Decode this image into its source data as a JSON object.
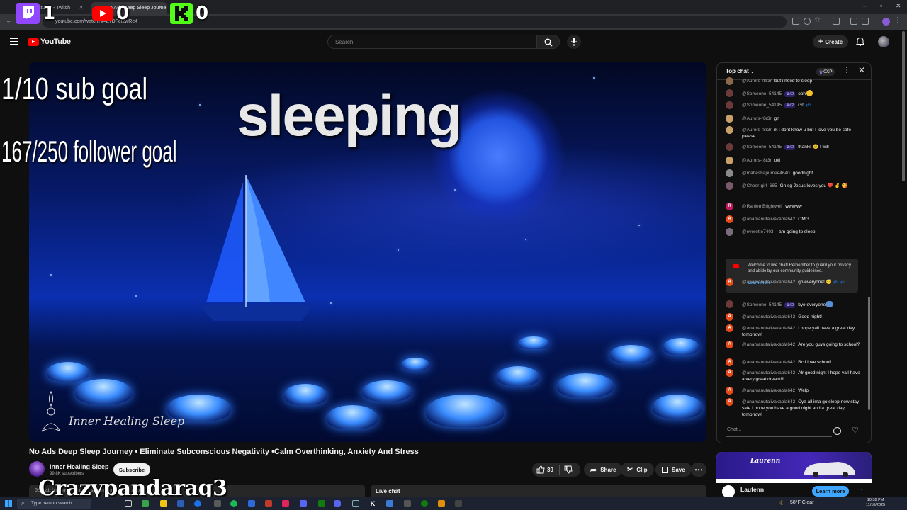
{
  "browser": {
    "tabs": [
      {
        "label": "yourSanctuary - Twitch",
        "active": false
      },
      {
        "label": "No Ads Deep Sleep Journe",
        "active": true
      }
    ],
    "url": "youtube.com/watch?v=a7DFel2wRe4"
  },
  "stream_overlay": {
    "counters": [
      {
        "platform": "twitch",
        "icon": "twitch-icon",
        "value": "1",
        "color": "#9146ff"
      },
      {
        "platform": "youtube",
        "icon": "youtube-icon",
        "value": "0",
        "color": "#ff0000"
      },
      {
        "platform": "kick",
        "icon": "kick-icon",
        "value": "0",
        "color": "#53fc18"
      }
    ],
    "sub_goal": "1/10 sub goal",
    "follower_goal": "167/250 follower goal",
    "status_text": "sleeping",
    "streamer_name": "Crazypandarag3"
  },
  "youtube": {
    "logo_text": "YouTube",
    "search_placeholder": "Search",
    "create_label": "Create"
  },
  "video": {
    "watermark": "Inner Healing Sleep",
    "title": "No Ads Deep Sleep Journey • Eliminate Subconscious Negativity •Calm Overthinking, Anxiety And Stress",
    "channel_name": "Inner Healing Sleep",
    "subscribers": "99.8K subscribers",
    "subscribe_label": "Subscribe",
    "likes": "39",
    "share_label": "Share",
    "clip_label": "Clip",
    "save_label": "Save",
    "description_preview": "58 watching now  Started streaming 3 hours ago",
    "live_chat_label": "Live chat"
  },
  "chat": {
    "mode": "Top chat",
    "xp": "0XP",
    "input_placeholder": "Chat...",
    "messages": [
      {
        "author": "@Auroro-r8r3r",
        "text": "but i need to sleep",
        "avatar_color": "#8a6a4a",
        "avatar_letter": ""
      },
      {
        "author": "@Someone_54145",
        "badge": "#2",
        "text": "ooh",
        "emoji": "#f2c12e",
        "avatar_color": "#6b3a3a",
        "avatar_letter": ""
      },
      {
        "author": "@Someone_54145",
        "badge": "#2",
        "text": "Gn 💤",
        "avatar_color": "#6b3a3a",
        "avatar_letter": ""
      },
      {
        "author": "@Aurors-r8r3r",
        "text": "gn",
        "avatar_color": "#c9a06a",
        "avatar_letter": ""
      },
      {
        "author": "@Aurors-r8r3r",
        "text": "ik i dont know u but I love you be safe please",
        "avatar_color": "#c9a06a",
        "avatar_letter": ""
      },
      {
        "author": "@Someone_54145",
        "badge": "#2",
        "text": "thanks 😊 I will",
        "avatar_color": "#6b3a3a",
        "avatar_letter": ""
      },
      {
        "author": "@Aurors-r8r3r",
        "text": "oki",
        "avatar_color": "#c9a06a",
        "avatar_letter": ""
      },
      {
        "author": "@maheshapumee4640",
        "text": "goodnight",
        "avatar_color": "#8a8a8a",
        "avatar_letter": ""
      },
      {
        "author": "@Cheer-girl_685",
        "text": "Gn sg Jesus loves you ❤️ ✌️ 🥰",
        "avatar_color": "#7a5a6a",
        "avatar_letter": ""
      },
      {
        "author": "@RahlemBrightwell",
        "text": "wwwww",
        "avatar_color": "#c2185b",
        "avatar_letter": "R"
      },
      {
        "author": "@anamanutalivakaola642",
        "text": "OMG",
        "avatar_color": "#e64a19",
        "avatar_letter": "A"
      },
      {
        "author": "@everette7403",
        "text": "I am going to sleep",
        "avatar_color": "#7a6a7a",
        "avatar_letter": ""
      },
      {
        "author": "@anamanutalivakaola642",
        "text": "gn everyone! 😴 💤 💤",
        "avatar_color": "#e64a19",
        "avatar_letter": "A"
      },
      {
        "author": "@Someone_54145",
        "badge": "#2",
        "text": "bye everyone",
        "avatar_color": "#6b3a3a",
        "avatar_letter": ""
      },
      {
        "author": "@anamanutalivakaola642",
        "text": "Good night!",
        "avatar_color": "#e64a19",
        "avatar_letter": "A"
      },
      {
        "author": "@anamanutalivakaola642",
        "text": "I hope yall have a great day tomorrow!",
        "avatar_color": "#e64a19",
        "avatar_letter": "A"
      },
      {
        "author": "@anamanutalivakaola642",
        "text": "Are you guys going to school?",
        "avatar_color": "#e64a19",
        "avatar_letter": "A"
      },
      {
        "author": "@anamanutalivakaola642",
        "text": "Bc I love school!",
        "avatar_color": "#e64a19",
        "avatar_letter": "A"
      },
      {
        "author": "@anamanutalivakaola642",
        "text": "Alr good night I hope yall have a very great dream!!!",
        "avatar_color": "#e64a19",
        "avatar_letter": "A"
      },
      {
        "author": "@anamanutalivakaola642",
        "text": "Welp",
        "avatar_color": "#e64a19",
        "avatar_letter": "A"
      },
      {
        "author": "@anamanutalivakaola642",
        "text": "Cya all ima go sleep now stay safe I hope you have a good night and a great day tomorrow!",
        "avatar_color": "#e64a19",
        "avatar_letter": "A"
      }
    ],
    "welcome": {
      "text": "Welcome to live chat! Remember to guard your privacy and abide by our community guidelines.",
      "learn_more": "Learn more"
    }
  },
  "ad": {
    "brand_logo": "Laurenn",
    "advertiser": "Laufenn",
    "cta": "Learn more"
  },
  "taskbar": {
    "search_placeholder": "Type here to search",
    "weather": "58°F  Clear",
    "time": "10:38 PM",
    "date": "11/10/2025"
  }
}
